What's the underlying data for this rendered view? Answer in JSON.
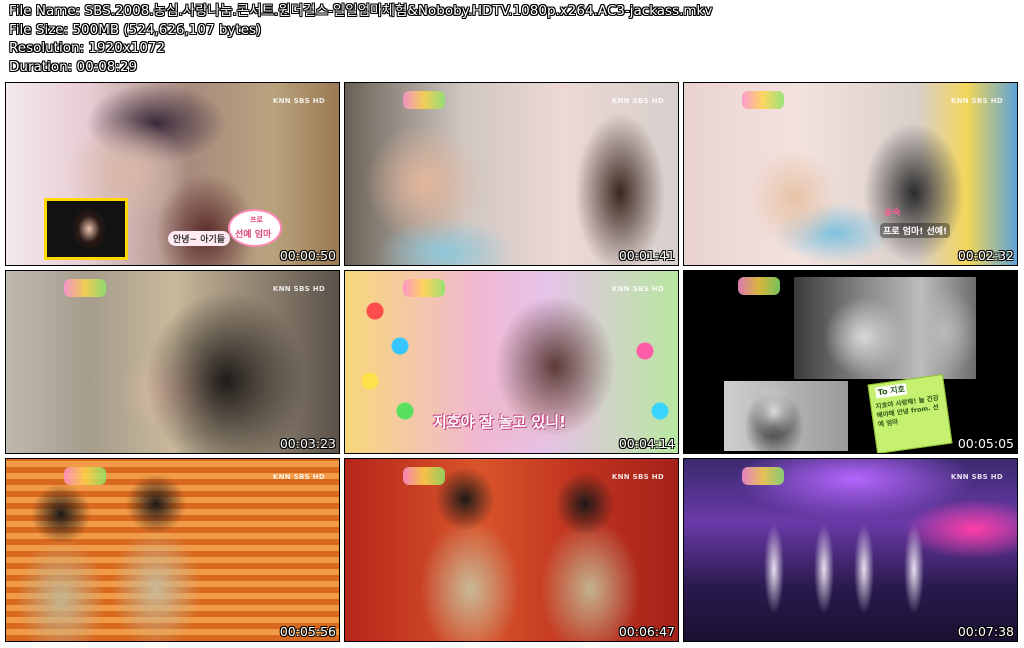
{
  "info": {
    "file_name": "File Name: SBS.2008.농심.사랑나눔.콘서트.원더걸스-일일엄마체험&Noboby.HDTV.1080p.x264.AC3-jackass.mkv",
    "file_size": "File Size: 500MB (524,626,107 bytes)",
    "resolution": "Resolution: 1920x1072",
    "duration": "Duration: 00:08:29"
  },
  "thumbnails": [
    {
      "timestamp": "00:00:50",
      "logo": "KNN SBS HD",
      "caption_1": "안녕~ 아기들",
      "caption_2": "프로",
      "caption_3": "선예 엄마"
    },
    {
      "timestamp": "00:01:41",
      "logo": "KNN SBS HD"
    },
    {
      "timestamp": "00:02:32",
      "logo": "KNN SBS HD",
      "caption_1": "승숙",
      "caption_2": "프로 엄마! 선예!"
    },
    {
      "timestamp": "00:03:23",
      "logo": "KNN SBS HD"
    },
    {
      "timestamp": "00:04:14",
      "logo": "KNN SBS HD",
      "caption_1": "지호야 잘 놀고 있니!"
    },
    {
      "timestamp": "00:05:05",
      "caption_1": "To 지호",
      "caption_2": "지호야 사랑해! 늘 건강해야해 안녕 from. 선예 엄마"
    },
    {
      "timestamp": "00:05:56",
      "logo": "KNN SBS HD"
    },
    {
      "timestamp": "00:06:47",
      "logo": "KNN SBS HD"
    },
    {
      "timestamp": "00:07:38",
      "logo": "KNN SBS HD"
    }
  ]
}
